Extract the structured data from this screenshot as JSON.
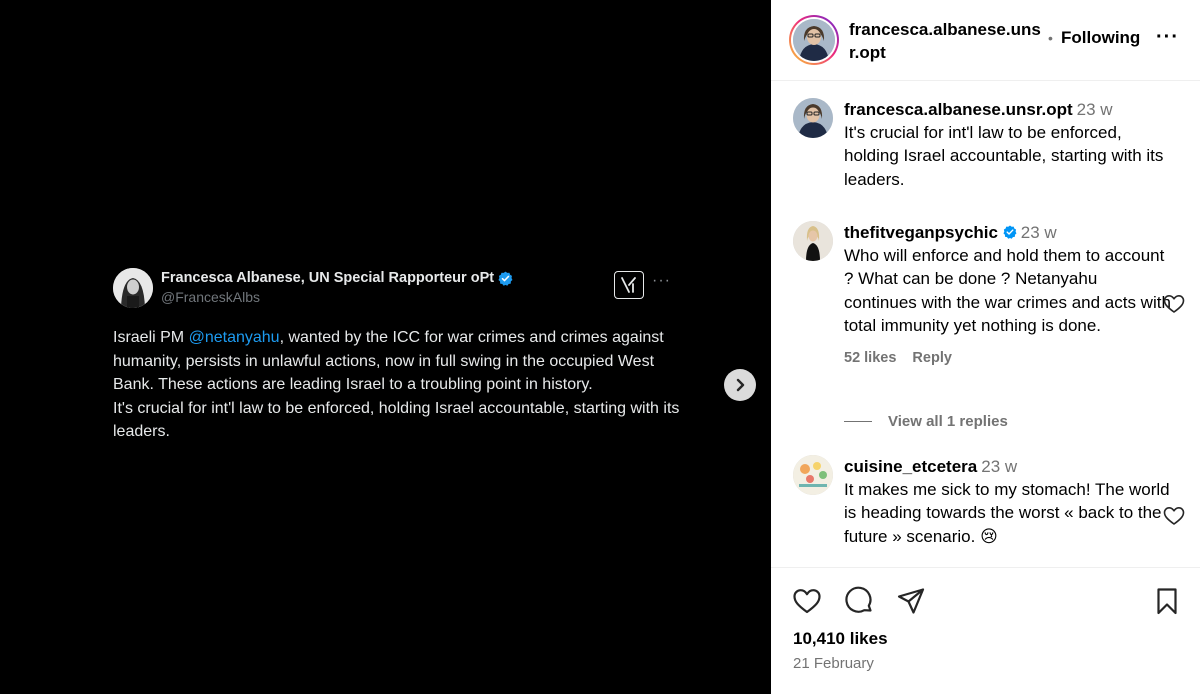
{
  "tweet": {
    "name": "Francesca Albanese, UN Special Rapporteur oPt",
    "handle": "@FranceskAlbs",
    "text_before": "Israeli PM ",
    "mention": "@netanyahu",
    "text_after": ", wanted by the ICC for war crimes and crimes against humanity, persists in unlawful actions, now in full swing in the occupied West Bank. These actions are leading Israel to a troubling point in history.",
    "text_line2": "It's crucial for int'l law to be enforced, holding Israel accountable, starting with its leaders.",
    "more": "···"
  },
  "header": {
    "username": "francesca.albanese.unsr.opt",
    "dot": "•",
    "follow_label": "Following",
    "more": "···"
  },
  "comments": [
    {
      "username": "francesca.albanese.unsr.opt",
      "time": "23 w",
      "text": "It's crucial for int'l law to be enforced, holding Israel accountable, starting with its leaders."
    },
    {
      "username": "thefitveganpsychic",
      "time": "23 w",
      "text": "Who will enforce and hold them to account ? What can be done ? Netanyahu continues with the war crimes and acts with total immunity yet nothing is done.",
      "likes": "52 likes",
      "reply": "Reply",
      "view_replies": "View all 1 replies"
    },
    {
      "username": "cuisine_etcetera",
      "time": "23 w",
      "text": "It makes me sick to my stomach! The world is heading towards the worst « back to the future » scenario. 😢"
    }
  ],
  "post": {
    "likes": "10,410 likes",
    "date": "21 February"
  },
  "colors": {
    "verified": "#1d9bf0",
    "mention": "#1d9bf0",
    "muted": "#737373"
  },
  "icons": [
    "verified-badge-icon",
    "x-logo-icon",
    "chevron-right-icon",
    "heart-icon",
    "comment-icon",
    "share-icon",
    "bookmark-icon"
  ]
}
